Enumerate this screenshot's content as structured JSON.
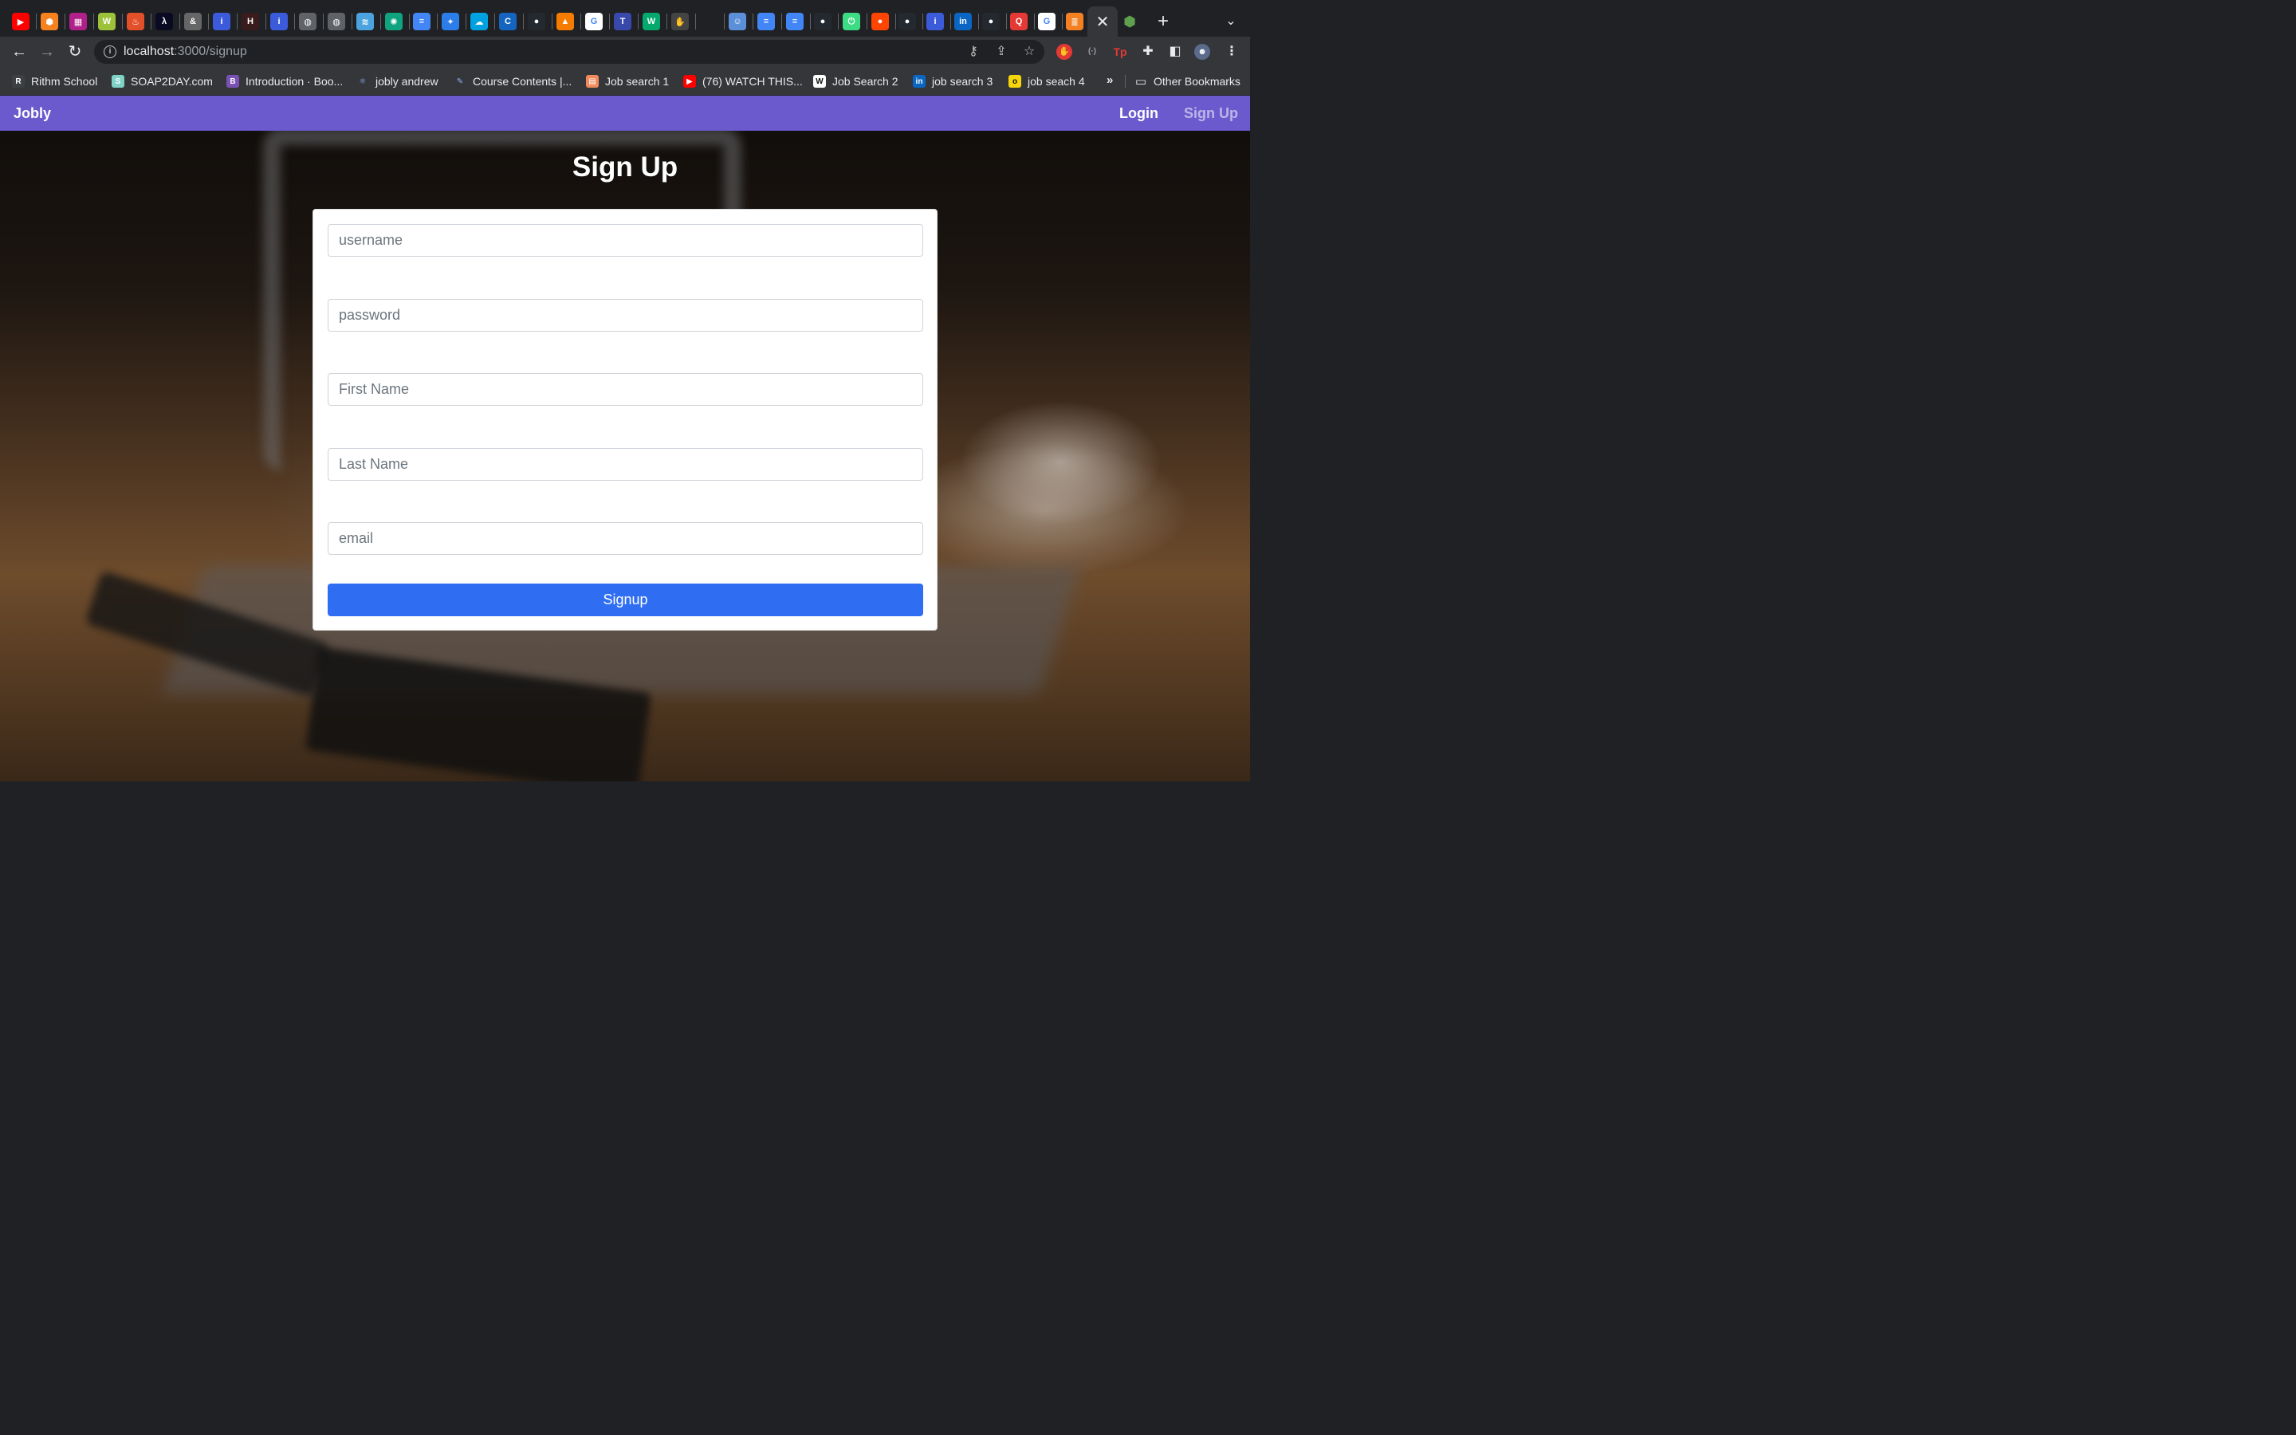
{
  "browser": {
    "tabs": [
      {
        "icon": "youtube-icon",
        "color": "#ff0000",
        "glyph": "▶"
      },
      {
        "icon": "box-icon",
        "color": "#f6821f",
        "glyph": "⬢"
      },
      {
        "icon": "grid-icon",
        "color": "#b0208a",
        "glyph": "▦"
      },
      {
        "icon": "wh-icon",
        "color": "#9cc23a",
        "glyph": "W"
      },
      {
        "icon": "flame-icon",
        "color": "#e2502a",
        "glyph": "♨"
      },
      {
        "icon": "fcc-icon",
        "color": "#0a0a23",
        "glyph": "λ"
      },
      {
        "icon": "ampersand-icon",
        "color": "#666666",
        "glyph": "&"
      },
      {
        "icon": "info-i-icon",
        "color": "#3b5bdb",
        "glyph": "i"
      },
      {
        "icon": "dark-h-icon",
        "color": "#3a1c1c",
        "glyph": "H"
      },
      {
        "icon": "info-i-icon",
        "color": "#3b5bdb",
        "glyph": "i"
      },
      {
        "icon": "globe-icon",
        "color": "#5f6368",
        "glyph": "◍"
      },
      {
        "icon": "globe-icon",
        "color": "#5f6368",
        "glyph": "◍"
      },
      {
        "icon": "layers-icon",
        "color": "#4aa3df",
        "glyph": "≋"
      },
      {
        "icon": "openai-icon",
        "color": "#10a37f",
        "glyph": "✺"
      },
      {
        "icon": "docs-icon",
        "color": "#4285f4",
        "glyph": "≡"
      },
      {
        "icon": "compass-icon",
        "color": "#2b7de9",
        "glyph": "✦"
      },
      {
        "icon": "cloud-icon",
        "color": "#00a1e0",
        "glyph": "☁"
      },
      {
        "icon": "cpuc-icon",
        "color": "#1565c0",
        "glyph": "C"
      },
      {
        "icon": "github-icon",
        "color": "#24292f",
        "glyph": "●"
      },
      {
        "icon": "triangle-icon",
        "color": "#f57c00",
        "glyph": "▲"
      },
      {
        "icon": "google-icon",
        "color": "#ffffff",
        "glyph": "G"
      },
      {
        "icon": "code-tag-icon",
        "color": "#3949ab",
        "glyph": "T"
      },
      {
        "icon": "w3-icon",
        "color": "#04aa6d",
        "glyph": "W"
      },
      {
        "icon": "hand-icon",
        "color": "#444444",
        "glyph": "✋"
      },
      {
        "icon": "blank-icon",
        "color": "#202124",
        "glyph": ""
      },
      {
        "icon": "avatar-icon",
        "color": "#5b8fd9",
        "glyph": "☺"
      },
      {
        "icon": "docs-icon",
        "color": "#4285f4",
        "glyph": "≡"
      },
      {
        "icon": "docs-icon",
        "color": "#4285f4",
        "glyph": "≡"
      },
      {
        "icon": "github-icon",
        "color": "#24292f",
        "glyph": "●"
      },
      {
        "icon": "green-power-icon",
        "color": "#3ddc84",
        "glyph": "⏻"
      },
      {
        "icon": "reddit-icon",
        "color": "#ff4500",
        "glyph": "●"
      },
      {
        "icon": "github-icon",
        "color": "#24292f",
        "glyph": "●"
      },
      {
        "icon": "info-i-icon",
        "color": "#3b5bdb",
        "glyph": "i"
      },
      {
        "icon": "linkedin-icon",
        "color": "#0a66c2",
        "glyph": "in"
      },
      {
        "icon": "github-icon",
        "color": "#24292f",
        "glyph": "●"
      },
      {
        "icon": "red-q-icon",
        "color": "#e53935",
        "glyph": "Q"
      },
      {
        "icon": "google-icon",
        "color": "#ffffff",
        "glyph": "G"
      },
      {
        "icon": "stackoverflow-icon",
        "color": "#f48024",
        "glyph": "≣"
      }
    ],
    "active_tab_icon": "close-icon",
    "after_tab_icon": {
      "icon": "nodejs-icon",
      "color": "#5fa04e",
      "glyph": "⬢"
    },
    "address": {
      "host": "localhost",
      "path": ":3000/signup"
    },
    "bookmarks": [
      {
        "label": "Rithm School",
        "icon": "rithm-icon",
        "color": "#3c4043",
        "glyph": "R"
      },
      {
        "label": "SOAP2DAY.com",
        "icon": "soap-icon",
        "color": "#7fd3c6",
        "glyph": "S"
      },
      {
        "label": "Introduction · Boo...",
        "icon": "bootstrap-icon",
        "color": "#7952b3",
        "glyph": "B"
      },
      {
        "label": "jobly andrew",
        "icon": "react-icon",
        "color": "#35363a",
        "glyph": "⚛"
      },
      {
        "label": "Course Contents |...",
        "icon": "feather-icon",
        "color": "#35363a",
        "glyph": "✎"
      },
      {
        "label": "Job search 1",
        "icon": "jobsearch-icon",
        "color": "#f08a5d",
        "glyph": "▤"
      },
      {
        "label": "(76) WATCH THIS...",
        "icon": "youtube-icon",
        "color": "#ff0000",
        "glyph": "▶"
      },
      {
        "label": "Job Search 2",
        "icon": "wellfound-icon",
        "color": "#ffffff",
        "glyph": "W"
      },
      {
        "label": "job search 3",
        "icon": "linkedin-icon",
        "color": "#0a66c2",
        "glyph": "in"
      },
      {
        "label": "job seach 4",
        "icon": "otta-icon",
        "color": "#f5d60a",
        "glyph": "o"
      }
    ],
    "bookmarks_overflow": "»",
    "other_bookmarks": "Other Bookmarks"
  },
  "navbar": {
    "brand": "Jobly",
    "login": "Login",
    "signup": "Sign Up",
    "color": "#6a5acd"
  },
  "page": {
    "title": "Sign Up",
    "fields": {
      "username_placeholder": "username",
      "password_placeholder": "password",
      "first_name_placeholder": "First Name",
      "last_name_placeholder": "Last Name",
      "email_placeholder": "email"
    },
    "submit_label": "Signup",
    "submit_color": "#2f6ef3"
  }
}
